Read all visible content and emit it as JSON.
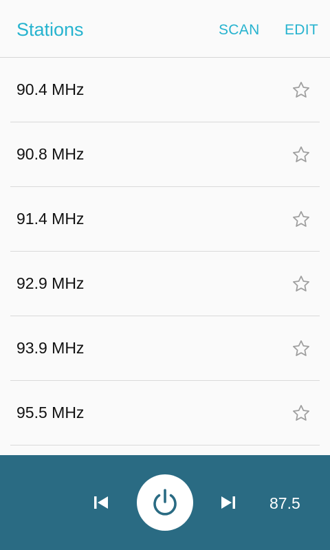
{
  "header": {
    "title": "Stations",
    "scan_label": "SCAN",
    "edit_label": "EDIT"
  },
  "stations": [
    {
      "label": "90.4 MHz",
      "favorite": false
    },
    {
      "label": "90.8 MHz",
      "favorite": false
    },
    {
      "label": "91.4 MHz",
      "favorite": false
    },
    {
      "label": "92.9 MHz",
      "favorite": false
    },
    {
      "label": "93.9 MHz",
      "favorite": false
    },
    {
      "label": "95.5 MHz",
      "favorite": false
    }
  ],
  "player": {
    "frequency": "87.5",
    "icons": [
      "skip-previous-icon",
      "power-icon",
      "skip-next-icon"
    ]
  },
  "colors": {
    "accent": "#26b3cf",
    "player_bg": "#2a6b83",
    "power_icon": "#2a6b83",
    "star_outline": "#9e9e9e"
  }
}
